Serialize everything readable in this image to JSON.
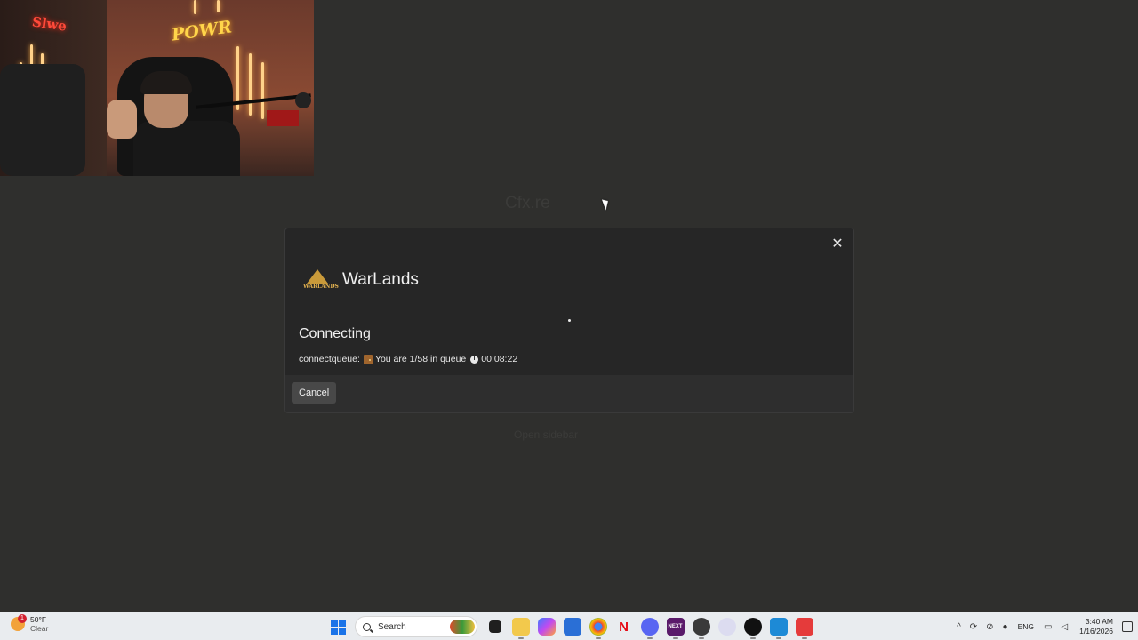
{
  "webcam": {
    "neon_sign": "POWR",
    "neon_red": "Slwe"
  },
  "background": {
    "faint_brand": "Cfx.re",
    "faint_footer": "Open sidebar"
  },
  "modal": {
    "server_name": "WarLands",
    "logo_text": "WARLANDS",
    "status_title": "Connecting",
    "queue_prefix": "connectqueue:",
    "queue_position": "You are 1/58 in queue",
    "queue_time": "00:08:22",
    "close_glyph": "✕",
    "cancel_label": "Cancel"
  },
  "taskbar": {
    "weather_temp": "50°F",
    "weather_cond": "Clear",
    "weather_badge": "1",
    "search_placeholder": "Search",
    "apps": [
      "start",
      "search",
      "task-view",
      "file-explorer",
      "copilot",
      "store",
      "chrome",
      "netflix",
      "discord",
      "next",
      "app-globe",
      "app-character",
      "obs",
      "app-wave",
      "fivem"
    ],
    "lang": "ENG",
    "time": "3:40 AM",
    "date": "1/16/2026"
  },
  "colors": {
    "desktop_bg": "#2f2f2d",
    "modal_bg": "#262626",
    "footer_bg": "#2e2e2e",
    "button_bg": "#484848",
    "taskbar_bg": "#e9ecef",
    "accent_blue": "#1a73e8"
  }
}
